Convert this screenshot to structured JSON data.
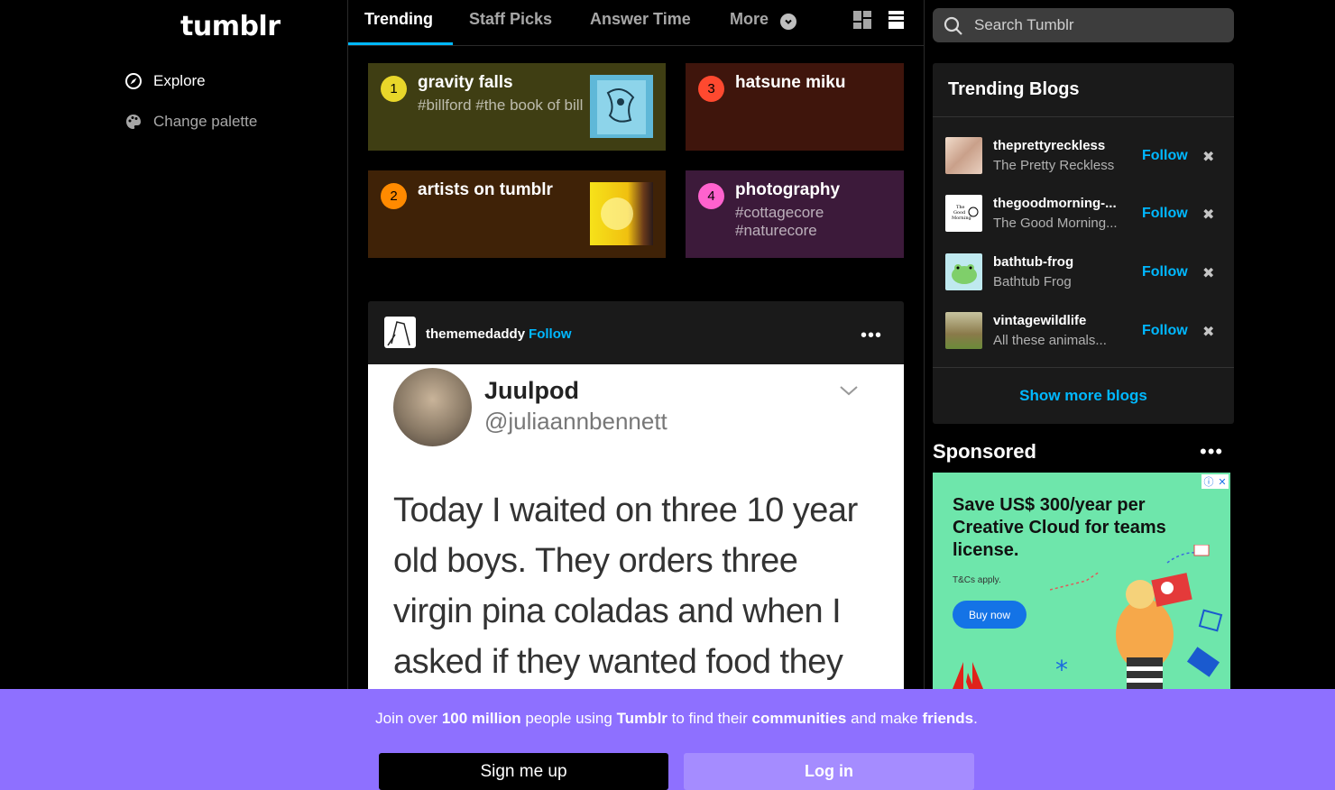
{
  "app": {
    "logo": "tumblr"
  },
  "leftnav": {
    "items": [
      {
        "label": "Explore",
        "icon": "compass-icon"
      },
      {
        "label": "Change palette",
        "icon": "palette-icon"
      }
    ]
  },
  "tabs": {
    "items": [
      {
        "label": "Trending",
        "active": true
      },
      {
        "label": "Staff Picks"
      },
      {
        "label": "Answer Time"
      },
      {
        "label": "More"
      }
    ],
    "view_icons": [
      "grid-view-icon",
      "list-view-icon"
    ]
  },
  "trending_tags": [
    {
      "rank": "1",
      "name": "gravity falls",
      "sub": "#billford #the book of bill",
      "rank_color": "#e8d62a",
      "bg": "#3f3e13"
    },
    {
      "rank": "2",
      "name": "artists on tumblr",
      "sub": "",
      "rank_color": "#ff8a00",
      "bg": "#3f2207"
    },
    {
      "rank": "3",
      "name": "hatsune miku",
      "sub": "",
      "rank_color": "#ff492f",
      "bg": "#3f150c"
    },
    {
      "rank": "4",
      "name": "photography",
      "sub": "#cottagecore #naturecore",
      "rank_color": "#ff62ce",
      "bg": "#3c1a3a"
    }
  ],
  "post": {
    "author": "thememedaddy",
    "follow_label": "Follow",
    "more_label": "•••",
    "tweet": {
      "name": "Juulpod",
      "handle": "@juliaannbennett",
      "text": "Today I waited on three 10 year old boys. They orders three virgin pina coladas and when I asked if they wanted food they"
    }
  },
  "search": {
    "placeholder": "Search Tumblr"
  },
  "trending_blogs": {
    "title": "Trending Blogs",
    "follow_label": "Follow",
    "blogs": [
      {
        "name": "theprettyreckless",
        "title": "The Pretty Reckless"
      },
      {
        "name": "thegoodmorning-...",
        "title": "The Good Morning..."
      },
      {
        "name": "bathtub-frog",
        "title": "Bathtub Frog"
      },
      {
        "name": "vintagewildlife",
        "title": "All these animals..."
      }
    ],
    "show_more": "Show more blogs"
  },
  "sponsored": {
    "title": "Sponsored",
    "dots": "•••",
    "ad": {
      "headline": "Save US$ 300/year per Creative Cloud for teams license.",
      "tc": "T&Cs apply.",
      "button": "Buy now"
    }
  },
  "banner": {
    "text_parts": [
      "Join over ",
      "100 million",
      " people using ",
      "Tumblr",
      " to find their ",
      "communities",
      " and make ",
      "friends",
      "."
    ],
    "signup": "Sign me up",
    "login": "Log in"
  }
}
